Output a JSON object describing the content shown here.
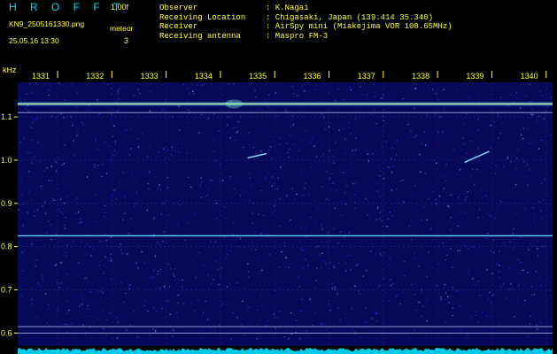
{
  "header": {
    "brand": "H R O F F T",
    "version": "1.00f",
    "filename": "KN9_2505161330.png",
    "timestamp": "25.05.16 13:30",
    "meteor_label": "meteor",
    "meteor_count": "3",
    "observer_label": "Observer",
    "observer_value": ": K.Nagai",
    "location_label": "Receiving Location",
    "location_value": ": Chigasaki, Japan (139.414 35.340)",
    "receiver_label": "Receiver",
    "receiver_value": ": AirSpy mini (Miakejima VOR 108.65MHz)",
    "antenna_label": "Receiving antenna",
    "antenna_value": ": Maspro FM-3"
  },
  "colors": {
    "background": "#000000",
    "label_yellow": "#ffff40",
    "brand_cyan": "#00e0e0",
    "plot_background": "#08085a",
    "noise_floor": "#00e0ff"
  },
  "chart_data": {
    "type": "heatmap",
    "title": "",
    "xlabel": "",
    "ylabel": "kHz",
    "x_ticks": [
      "1331",
      "1332",
      "1333",
      "1334",
      "1335",
      "1336",
      "1337",
      "1338",
      "1339",
      "1340"
    ],
    "y_ticks": [
      "1.1",
      "1.0",
      "0.9",
      "0.8",
      "0.7",
      "0.6"
    ],
    "ylim": [
      0.57,
      1.18
    ],
    "carrier_lines_khz": [
      1.13,
      1.11,
      0.825,
      0.615,
      0.6
    ],
    "meteor_echoes": [
      {
        "x_start": 1334.5,
        "y_start": 1.005,
        "x_end": 1334.85,
        "y_end": 1.015
      },
      {
        "x_start": 1338.5,
        "y_start": 0.995,
        "x_end": 1338.95,
        "y_end": 1.02
      }
    ]
  }
}
